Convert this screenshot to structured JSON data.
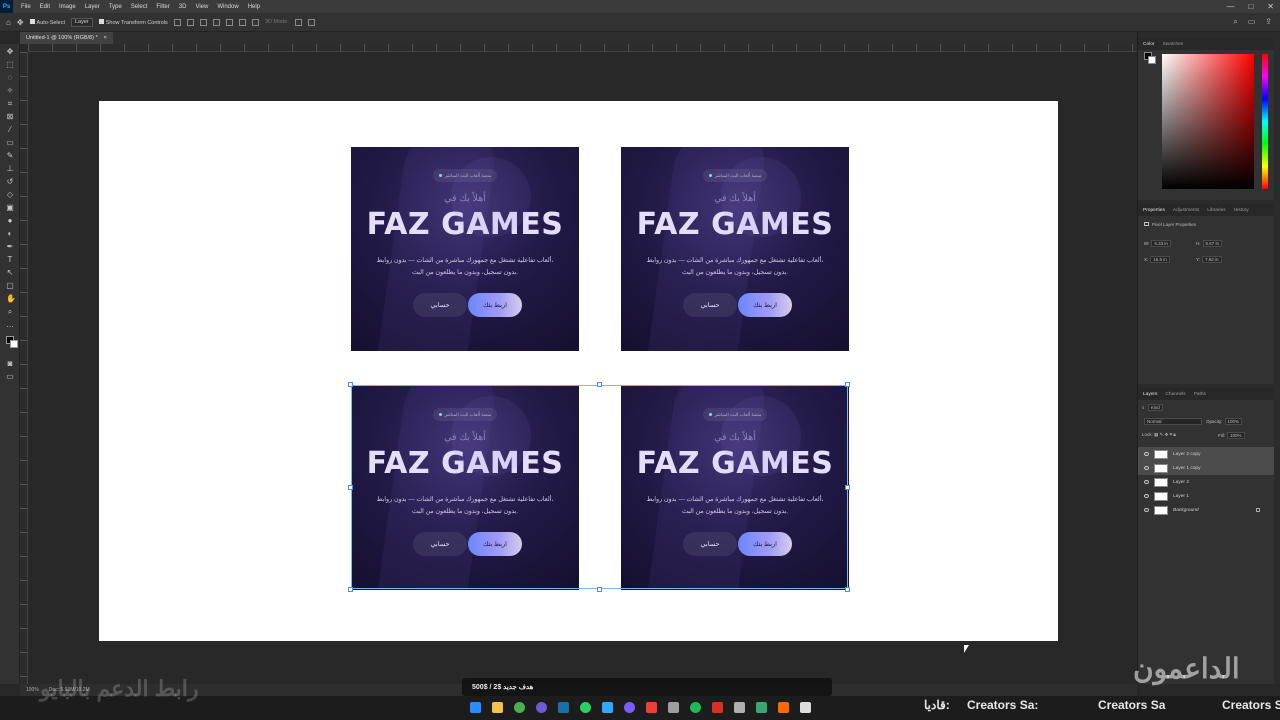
{
  "app": {
    "logo": "Ps"
  },
  "menu": [
    "File",
    "Edit",
    "Image",
    "Layer",
    "Type",
    "Select",
    "Filter",
    "3D",
    "View",
    "Window",
    "Help"
  ],
  "window_controls": [
    "—",
    "□",
    "✕"
  ],
  "options_bar": {
    "auto_select_label": "Auto-Select",
    "auto_select_value": "Layer",
    "transform_controls_label": "Show Transform Controls",
    "mode_label": "3D Mode:"
  },
  "doc_tab": {
    "title": "Untitled-1 @ 100% (RGB/8) *",
    "close": "×"
  },
  "card": {
    "badge": "منصة ألعاب البث المباشر",
    "welcome": "أهلاً بك في",
    "title": "FAZ GAMES",
    "desc_line1": "ألعاب تفاعلية تشتغل مع جمهورك مباشرة من الشات — بدون روابط،",
    "desc_line2": "بدون تسجيل، وبدون ما يطلعون من البث.",
    "btn_secondary": "حسابي",
    "btn_primary": "اربط بثك"
  },
  "panels": {
    "color_tabs": [
      "Color",
      "Swatches"
    ],
    "properties_tabs": [
      "Properties",
      "Adjustments",
      "Libraries",
      "History"
    ],
    "properties_title": "Pixel Layer Properties",
    "w_label": "W:",
    "w_value": "6.33 in",
    "h_label": "H:",
    "h_value": "5.67 in",
    "x_label": "X:",
    "x_value": "16.5 in",
    "y_label": "Y:",
    "y_value": "7.92 in",
    "layers_tabs": [
      "Layers",
      "Channels",
      "Paths"
    ],
    "kind_label": "Kind",
    "blend_mode": "Normal",
    "opacity_label": "Opacity:",
    "opacity_value": "100%",
    "lock_label": "Lock:",
    "fill_label": "Fill:",
    "fill_value": "100%",
    "layers": [
      {
        "name": "Layer 2 copy",
        "selected": true
      },
      {
        "name": "Layer 1 copy",
        "selected": true
      },
      {
        "name": "Layer 2",
        "selected": false
      },
      {
        "name": "Layer 1",
        "selected": false
      },
      {
        "name": "Background",
        "selected": false
      }
    ]
  },
  "status": {
    "zoom": "100%",
    "doc": "Doc: 5.93M/10.2M"
  },
  "overlays": {
    "goal": "هدف جديد  $2 / $500",
    "ticker_1": "قاديا:",
    "ticker_2": "Creators Sa:",
    "ticker_3": "Creators Sa",
    "ticker_4": "Creators S",
    "watermark_right": "الداعمون",
    "watermark_left": "رابط الدعم بالبايو"
  },
  "taskbar_icons": [
    {
      "name": "windows-start-icon",
      "color": "#2b8cff"
    },
    {
      "name": "file-explorer-icon",
      "color": "#f2c14e"
    },
    {
      "name": "chrome-icon",
      "color": "#4caf50"
    },
    {
      "name": "browser-icon",
      "color": "#6d5bd0"
    },
    {
      "name": "steam-icon",
      "color": "#1b6fa8"
    },
    {
      "name": "whatsapp-icon",
      "color": "#25d366"
    },
    {
      "name": "photoshop-icon",
      "color": "#31a8ff"
    },
    {
      "name": "messenger-icon",
      "color": "#7b5cff"
    },
    {
      "name": "chrome-alt-icon",
      "color": "#e94235"
    },
    {
      "name": "settings-icon",
      "color": "#9e9e9e"
    },
    {
      "name": "spotify-icon",
      "color": "#1db954"
    },
    {
      "name": "app-red-icon",
      "color": "#d93025"
    },
    {
      "name": "app-box-icon",
      "color": "#b0b0b0"
    },
    {
      "name": "app-green-icon",
      "color": "#3aa675"
    },
    {
      "name": "app-orange-icon",
      "color": "#ff6a00"
    },
    {
      "name": "app-font-icon",
      "color": "#dddddd"
    }
  ]
}
